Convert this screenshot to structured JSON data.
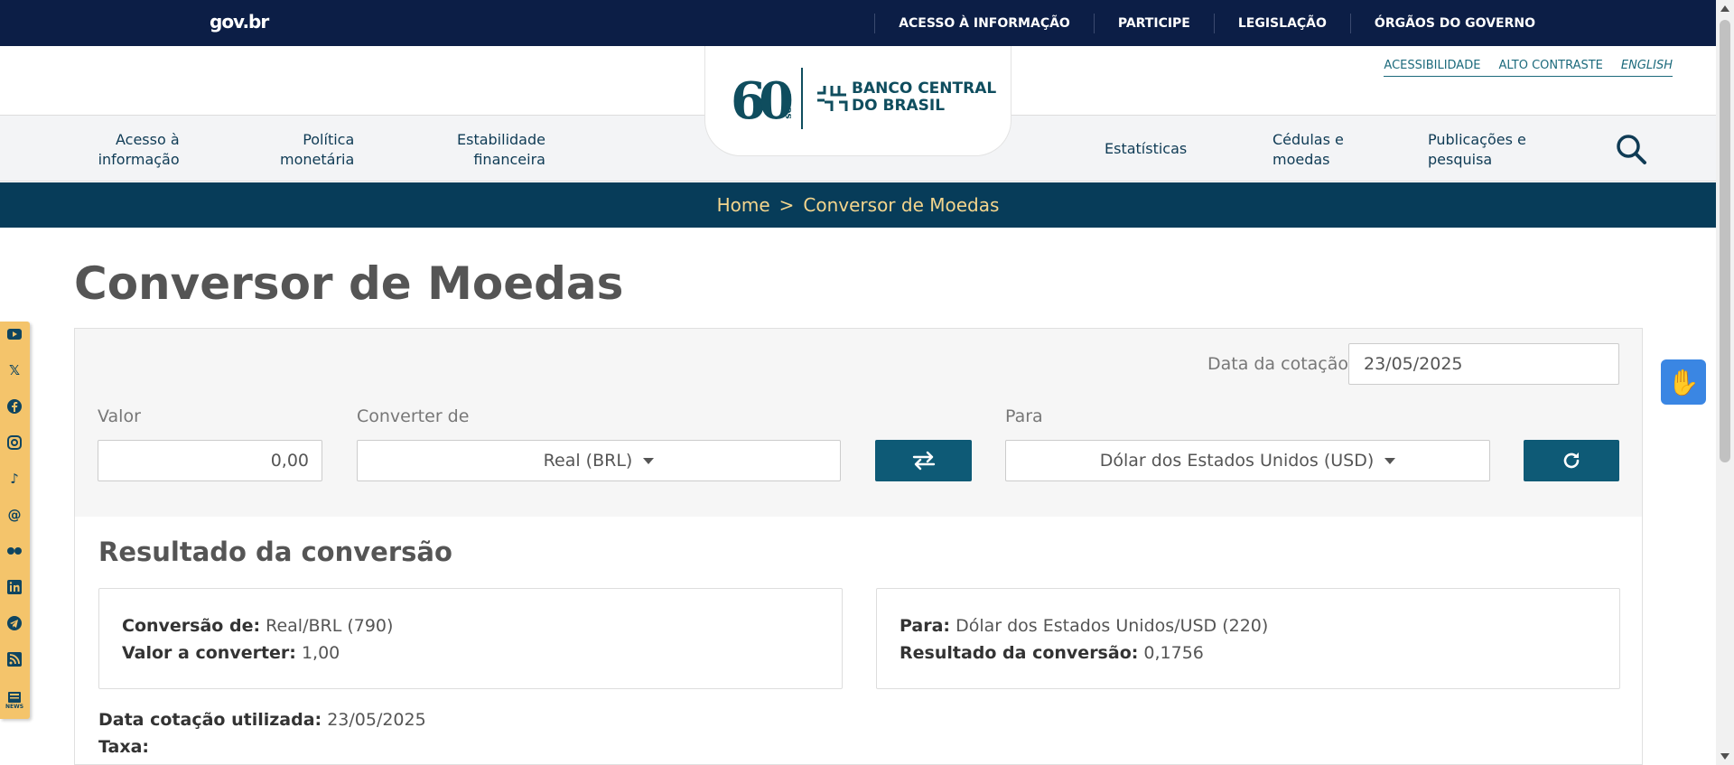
{
  "govbar": {
    "logo": "gov.br",
    "links": [
      "ACESSO À INFORMAÇÃO",
      "PARTICIPE",
      "LEGISLAÇÃO",
      "ÓRGÃOS DO GOVERNO"
    ]
  },
  "accessibility": {
    "acessibilidade": "ACESSIBILIDADE",
    "alto_contraste": "ALTO CONTRASTE",
    "english": "ENGLISH"
  },
  "logo": {
    "sixty": "60",
    "anos": "anos",
    "name_line1": "BANCO CENTRAL",
    "name_line2": "DO BRASIL"
  },
  "nav": {
    "acesso_l1": "Acesso à",
    "acesso_l2": "informação",
    "politica_l1": "Política",
    "politica_l2": "monetária",
    "estabilidade_l1": "Estabilidade",
    "estabilidade_l2": "financeira",
    "estatisticas": "Estatísticas",
    "cedulas_l1": "Cédulas e",
    "cedulas_l2": "moedas",
    "publicacoes_l1": "Publicações e",
    "publicacoes_l2": "pesquisa"
  },
  "breadcrumb": {
    "home": "Home",
    "separator": ">",
    "current": "Conversor de Moedas"
  },
  "page_title": "Conversor de Moedas",
  "form": {
    "date_label": "Data da cotação",
    "date_value": "23/05/2025",
    "valor_label": "Valor",
    "valor_value": "0,00",
    "from_label": "Converter de",
    "from_value": "Real (BRL)",
    "to_label": "Para",
    "to_value": "Dólar dos Estados Unidos (USD)"
  },
  "result": {
    "title": "Resultado da conversão",
    "conversao_de_label": "Conversão de:",
    "conversao_de_value": "Real/BRL (790)",
    "valor_label": "Valor a converter:",
    "valor_value": "1,00",
    "para_label": "Para:",
    "para_value": "Dólar dos Estados Unidos/USD (220)",
    "resultado_label": "Resultado da conversão:",
    "resultado_value": "0,1756",
    "data_label": "Data cotação utilizada:",
    "data_value": "23/05/2025",
    "taxa_label": "Taxa:"
  },
  "social": [
    "youtube-icon",
    "x-icon",
    "facebook-icon",
    "instagram-icon",
    "tiktok-icon",
    "threads-icon",
    "flickr-icon",
    "linkedin-icon",
    "telegram-icon",
    "rss-icon",
    "news-icon"
  ],
  "social_news_label": "NEWS",
  "colors": {
    "govbar": "#0c1e46",
    "brand": "#0f4d5e",
    "breadcrumb_bg": "#073c59",
    "breadcrumb_text": "#f4d58d",
    "button": "#0e5a76",
    "social_bar": "#f4c46b",
    "vlibras": "#3a86e3"
  }
}
